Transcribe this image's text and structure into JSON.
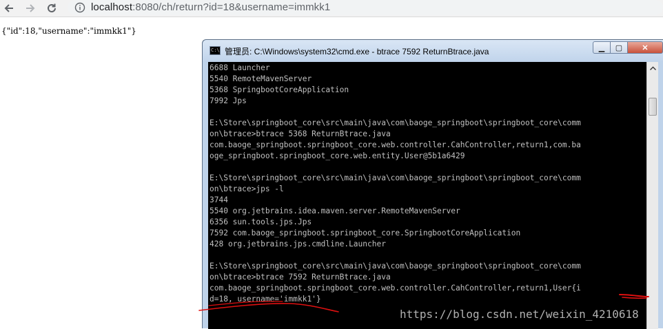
{
  "browser": {
    "url_host": "localhost",
    "url_rest": ":8080/ch/return?id=18&username=immkk1",
    "back_icon": "arrow-left-icon",
    "forward_icon": "arrow-right-icon",
    "reload_icon": "reload-icon",
    "info_icon": "info-icon"
  },
  "page": {
    "json_response": "{\"id\":18,\"username\":\"immkk1\"}"
  },
  "cmd": {
    "title": "管理员: C:\\Windows\\system32\\cmd.exe - btrace  7592 ReturnBtrace.java",
    "icon_text": "C:\\",
    "minimize_label": "▁",
    "maximize_label": "▢",
    "close_label": "✕",
    "lines": [
      "6688 Launcher",
      "5540 RemoteMavenServer",
      "5368 SpringbootCoreApplication",
      "7992 Jps",
      "",
      "E:\\Store\\springboot_core\\src\\main\\java\\com\\baoge_springboot\\springboot_core\\comm",
      "on\\btrace>btrace 5368 ReturnBtrace.java",
      "com.baoge_springboot.springboot_core.web.controller.CahController,return1,com.ba",
      "oge_springboot.springboot_core.web.entity.User@5b1a6429",
      "",
      "E:\\Store\\springboot_core\\src\\main\\java\\com\\baoge_springboot\\springboot_core\\comm",
      "on\\btrace>jps -l",
      "3744",
      "5540 org.jetbrains.idea.maven.server.RemoteMavenServer",
      "6356 sun.tools.jps.Jps",
      "7592 com.baoge_springboot.springboot_core.SpringbootCoreApplication",
      "428 org.jetbrains.jps.cmdline.Launcher",
      "",
      "E:\\Store\\springboot_core\\src\\main\\java\\com\\baoge_springboot\\springboot_core\\comm",
      "on\\btrace>btrace 7592 ReturnBtrace.java",
      "com.baoge_springboot.springboot_core.web.controller.CahController,return1,User{i",
      "d=18, username='immkk1'}"
    ]
  },
  "watermark": "https://blog.csdn.net/weixin_4210618",
  "colors": {
    "console_bg": "#000000",
    "console_fg": "#c0c0c0",
    "annotation_red": "#e01010"
  }
}
